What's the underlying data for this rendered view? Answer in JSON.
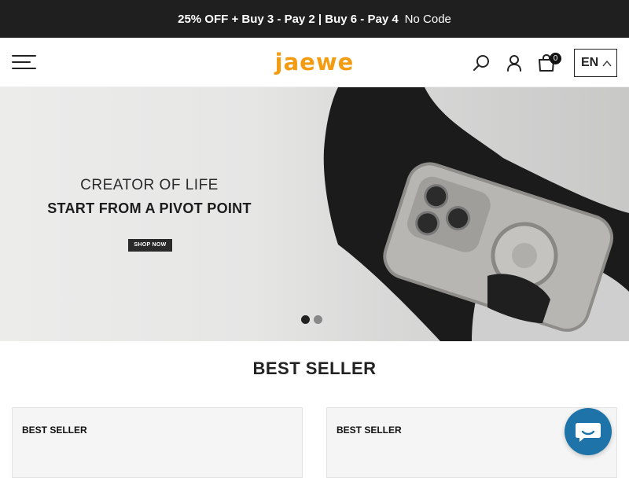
{
  "announcement": {
    "promo": "25% OFF + Buy 3 - Pay 2 | Buy 6 - Pay 4",
    "code": "No Code"
  },
  "header": {
    "logo": "jaewe",
    "cart_count": "0",
    "language": "EN",
    "icons": [
      "menu-icon",
      "search-icon",
      "account-icon",
      "cart-icon",
      "chevron-up-icon"
    ]
  },
  "hero": {
    "line1": "CREATOR OF LIFE",
    "line2": "START FROM A PIVOT POINT",
    "button": "SHOP NOW",
    "slides": 2,
    "active_slide": 1
  },
  "best_seller": {
    "title": "BEST SELLER",
    "cards": [
      {
        "label": "BEST SELLER"
      },
      {
        "label": "BEST SELLER"
      }
    ]
  },
  "colors": {
    "announcement_bg": "#1f1f1f",
    "logo": "#f39c12",
    "chat": "#1e73a8"
  }
}
